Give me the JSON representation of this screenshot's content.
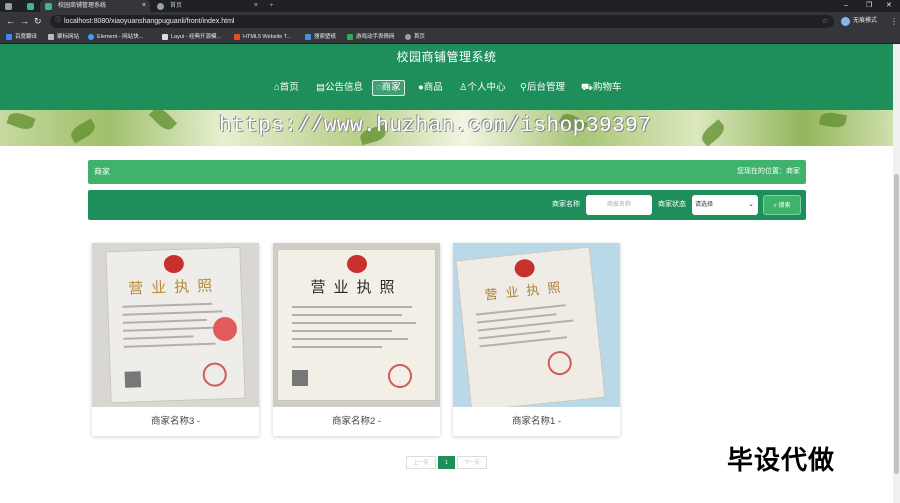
{
  "browser": {
    "tabs": [
      {
        "title": "校园商铺管理系统"
      },
      {
        "title": "首页"
      }
    ],
    "new_tab": "+",
    "url": "localhost:8080/xiaoyuanshangpuguanli/front/index.html",
    "profile": "无痕模式",
    "bookmarks": [
      "百度翻译",
      "聚标网站",
      "Element - 网站快...",
      "Layui - 经典开源模...",
      "HTML5 Website T...",
      "搜索壁纸",
      "游戏动手表情网",
      "首页"
    ]
  },
  "site": {
    "title": "校园商铺管理系统",
    "nav": [
      "首页",
      "公告信息",
      "商家",
      "商品",
      "个人中心",
      "后台管理",
      "购物车"
    ],
    "active_nav": "商家",
    "watermark": "https://www.huzhan.com/ishop39397"
  },
  "breadcrumb": {
    "title": "商家",
    "location_label": "您现在的位置：",
    "location_value": "商家"
  },
  "search": {
    "name_label": "商家名称",
    "name_placeholder": "商家名称",
    "status_label": "商家状态",
    "status_value": "请选择",
    "button_label": "搜索"
  },
  "merchants": [
    {
      "name": "商家名称3 -",
      "cert_title": "营业执照"
    },
    {
      "name": "商家名称2 -",
      "cert_title": "营业执照"
    },
    {
      "name": "商家名称1 -",
      "cert_title": "营业执照"
    }
  ],
  "pagination": {
    "prev": "上一页",
    "current": "1",
    "next": "下一页"
  },
  "promo_text": "毕设代做"
}
